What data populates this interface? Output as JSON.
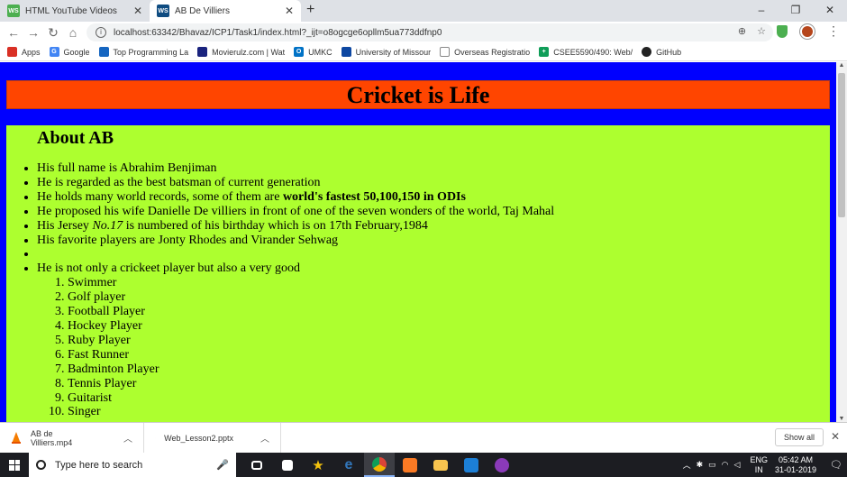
{
  "browser": {
    "tabs": [
      {
        "title": "HTML YouTube Videos",
        "favicon": "WS",
        "favicon_color": "#4caf50"
      },
      {
        "title": "AB De Villiers",
        "favicon": "WS",
        "favicon_color": "#0f4c81"
      }
    ],
    "url": "localhost:63342/Bhavaz/ICP1/Task1/index.html?_ijt=o8ogcge6opllm5ua773ddfnp0",
    "bookmarks": [
      {
        "label": "Apps",
        "icon": "apps-icon",
        "color": "#d93025"
      },
      {
        "label": "Google",
        "icon": "google-icon",
        "color": "#4285f4"
      },
      {
        "label": "Top Programming La",
        "icon": "doc-icon",
        "color": "#1565c0"
      },
      {
        "label": "Movierulz.com | Wat",
        "icon": "movie-icon",
        "color": "#1a237e"
      },
      {
        "label": "UMKC",
        "icon": "outlook-icon",
        "color": "#0072c6"
      },
      {
        "label": "University of Missour",
        "icon": "umkc-icon",
        "color": "#0d47a1"
      },
      {
        "label": "Overseas Registratio",
        "icon": "page-icon",
        "color": "#888888"
      },
      {
        "label": "CSEE5590/490: Web/",
        "icon": "plus-icon",
        "color": "#0f9d58"
      },
      {
        "label": "GitHub",
        "icon": "github-icon",
        "color": "#222222"
      }
    ]
  },
  "page": {
    "title": "Cricket is Life",
    "subtitle": "About AB",
    "facts": {
      "f1": "His full name is Abrahim Benjiman",
      "f2": "He is regarded as the best batsman of current generation",
      "f3_pre": "He holds many world records, some of them are ",
      "f3_bold": "world's fastest 50,100,150 in ODIs",
      "f4": "He proposed his wife Danielle De villiers in front of one of the seven wonders of the world, Taj Mahal",
      "f5_pre": "His Jersey ",
      "f5_em": "No.17",
      "f5_post": " is numbered of his birthday which is on 17th February,1984",
      "f6": "His favorite players are Jonty Rhodes and Virander Sehwag",
      "f7": "",
      "f8": "He is not only a crickeet player but also a very good"
    },
    "skills": [
      "Swimmer",
      "Golf player",
      "Football Player",
      "Hockey Player",
      "Ruby Player",
      "Fast Runner",
      "Badminton Player",
      "Tennis Player",
      "Guitarist",
      "Singer"
    ],
    "colors": {
      "header_bg": "#ff4500",
      "content_bg": "#adff2f",
      "page_bg": "#0000ff"
    }
  },
  "downloads": {
    "items": [
      {
        "name": "AB de Villiers.mp4",
        "icon": "vlc-icon"
      },
      {
        "name": "Web_Lesson2.pptx",
        "icon": "pptx-icon"
      }
    ],
    "show_all": "Show all"
  },
  "taskbar": {
    "search_placeholder": "Type here to search",
    "lang_line1": "ENG",
    "lang_line2": "IN",
    "time": "05:42 AM",
    "date": "31-01-2019"
  }
}
